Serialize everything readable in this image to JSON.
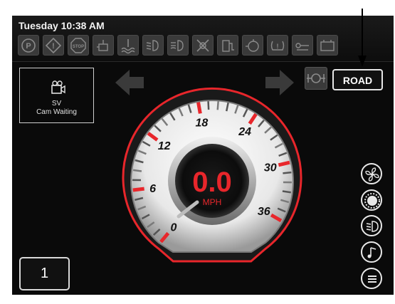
{
  "header": {
    "datetime": "Tuesday 10:38 AM"
  },
  "telltales": [
    {
      "name": "parking-brake-icon",
      "label": "P"
    },
    {
      "name": "hazard-icon",
      "label": "!"
    },
    {
      "name": "stop-icon",
      "label": "STOP"
    },
    {
      "name": "oil-pressure-icon",
      "label": ""
    },
    {
      "name": "coolant-temp-icon",
      "label": ""
    },
    {
      "name": "low-beam-icon",
      "label": ""
    },
    {
      "name": "fog-light-icon",
      "label": ""
    },
    {
      "name": "differential-lock-icon",
      "label": ""
    },
    {
      "name": "fuel-pump-icon",
      "label": ""
    },
    {
      "name": "engine-check-icon",
      "label": ""
    },
    {
      "name": "tire-pressure-icon",
      "label": ""
    },
    {
      "name": "transmission-icon",
      "label": ""
    },
    {
      "name": "battery-icon",
      "label": ""
    }
  ],
  "mode_button": {
    "label": "ROAD"
  },
  "camera": {
    "title": "SV",
    "status": "Cam Waiting"
  },
  "speedometer": {
    "value": "0.0",
    "unit": "MPH",
    "ticks": [
      "0",
      "6",
      "12",
      "18",
      "24",
      "30",
      "36"
    ]
  },
  "gear": {
    "value": "1"
  },
  "side_controls": [
    "fan-icon",
    "brightness-icon",
    "headlight-icon",
    "music-icon",
    "menu-icon"
  ],
  "colors": {
    "accent_red": "#e8262b",
    "background": "#0a0a0a"
  }
}
